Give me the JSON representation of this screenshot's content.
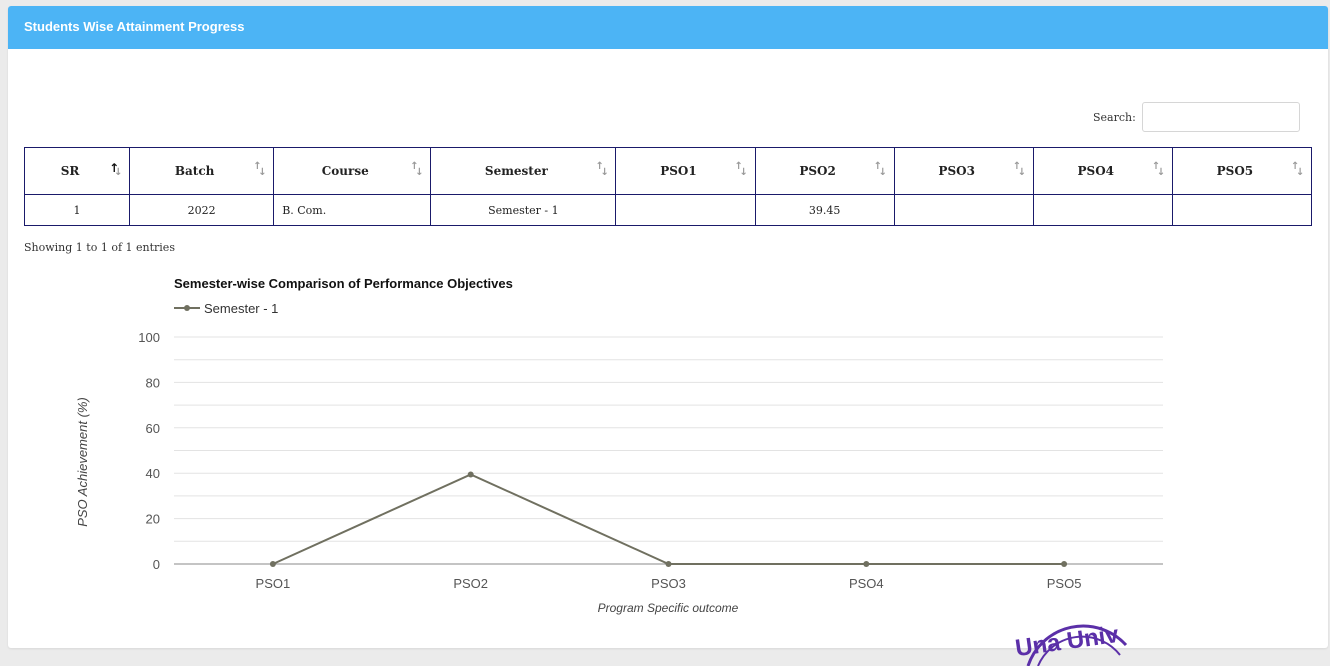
{
  "panel": {
    "title": "Students Wise Attainment Progress"
  },
  "search": {
    "label": "Search:",
    "value": ""
  },
  "table": {
    "columns": [
      "SR",
      "Batch",
      "Course",
      "Semester",
      "PSO1",
      "PSO2",
      "PSO3",
      "PSO4",
      "PSO5"
    ],
    "sorted_column": "SR",
    "rows": [
      [
        "1",
        "2022",
        "B. Com.",
        "Semester - 1",
        "",
        "39.45",
        "",
        "",
        ""
      ]
    ]
  },
  "info": "Showing 1 to 1 of 1 entries",
  "stamp": {
    "text": "Una Univ"
  },
  "chart_data": {
    "type": "line",
    "title": "Semester-wise Comparison of Performance Objectives",
    "categories": [
      "PSO1",
      "PSO2",
      "PSO3",
      "PSO4",
      "PSO5"
    ],
    "series": [
      {
        "name": "Semester - 1",
        "values": [
          0,
          39.45,
          0,
          0,
          0
        ],
        "color": "#707060"
      }
    ],
    "xlabel": "Program Specific outcome",
    "ylabel": "PSO Achievement (%)",
    "ylim": [
      0,
      100
    ],
    "yticks": [
      0,
      20,
      40,
      60,
      80,
      100
    ],
    "grid": true,
    "legend": "top-left"
  }
}
